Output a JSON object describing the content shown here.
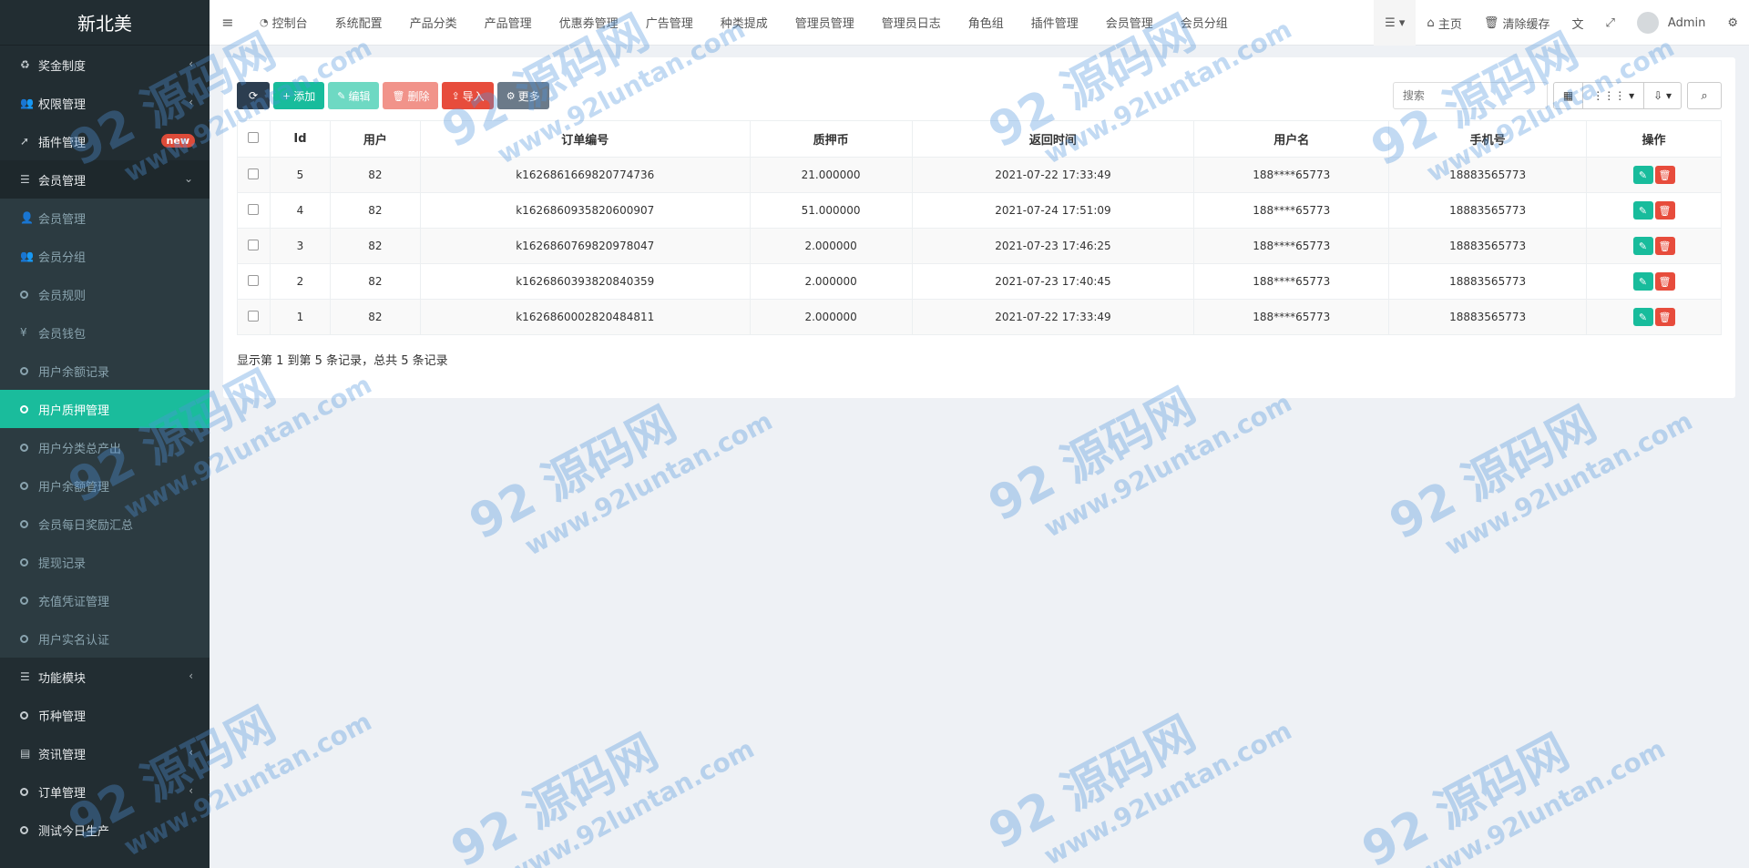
{
  "app": {
    "brand": "新北美"
  },
  "sidebar": {
    "items": [
      {
        "label": "奖金制度",
        "icon": "recycle-icon",
        "chevron": "‹"
      },
      {
        "label": "权限管理",
        "icon": "users-icon",
        "chevron": "‹"
      },
      {
        "label": "插件管理",
        "icon": "rocket-icon",
        "badge": "new"
      },
      {
        "label": "会员管理",
        "icon": "list-icon",
        "chevron": "⌄"
      },
      {
        "label": "会员管理",
        "icon": "user-icon"
      },
      {
        "label": "会员分组",
        "icon": "users-icon"
      },
      {
        "label": "会员规则",
        "icon": "circle-icon"
      },
      {
        "label": "会员钱包",
        "icon": "yen-icon"
      },
      {
        "label": "用户余额记录",
        "icon": "circle-icon"
      },
      {
        "label": "用户质押管理",
        "icon": "circle-icon"
      },
      {
        "label": "用户分类总产出",
        "icon": "circle-icon"
      },
      {
        "label": "用户余额管理",
        "icon": "circle-icon"
      },
      {
        "label": "会员每日奖励汇总",
        "icon": "circle-icon"
      },
      {
        "label": "提现记录",
        "icon": "circle-icon"
      },
      {
        "label": "充值凭证管理",
        "icon": "circle-icon"
      },
      {
        "label": "用户实名认证",
        "icon": "circle-icon"
      },
      {
        "label": "功能模块",
        "icon": "list-icon",
        "chevron": "‹"
      },
      {
        "label": "币种管理",
        "icon": "circle-icon"
      },
      {
        "label": "资讯管理",
        "icon": "news-icon",
        "chevron": "‹"
      },
      {
        "label": "订单管理",
        "icon": "circle-icon",
        "chevron": "‹"
      },
      {
        "label": "测试今日生产",
        "icon": "circle-icon"
      }
    ]
  },
  "topnav": {
    "items": [
      "控制台",
      "系统配置",
      "产品分类",
      "产品管理",
      "优惠券管理",
      "广告管理",
      "种类提成",
      "管理员管理",
      "管理员日志",
      "角色组",
      "插件管理",
      "会员管理",
      "会员分组"
    ],
    "home": "主页",
    "clear_cache": "清除缓存",
    "user": "Admin"
  },
  "toolbar": {
    "add": "添加",
    "edit": "编辑",
    "delete": "删除",
    "import": "导入",
    "more": "更多",
    "search_placeholder": "搜索"
  },
  "table": {
    "columns": [
      "Id",
      "用户",
      "订单编号",
      "质押币",
      "返回时间",
      "用户名",
      "手机号",
      "操作"
    ],
    "rows": [
      {
        "id": "5",
        "user": "82",
        "order": "k1626861669820774736",
        "amount": "21.000000",
        "time": "2021-07-22 17:33:49",
        "username": "188****65773",
        "phone": "18883565773"
      },
      {
        "id": "4",
        "user": "82",
        "order": "k1626860935820600907",
        "amount": "51.000000",
        "time": "2021-07-24 17:51:09",
        "username": "188****65773",
        "phone": "18883565773"
      },
      {
        "id": "3",
        "user": "82",
        "order": "k1626860769820978047",
        "amount": "2.000000",
        "time": "2021-07-23 17:46:25",
        "username": "188****65773",
        "phone": "18883565773"
      },
      {
        "id": "2",
        "user": "82",
        "order": "k1626860393820840359",
        "amount": "2.000000",
        "time": "2021-07-23 17:40:45",
        "username": "188****65773",
        "phone": "18883565773"
      },
      {
        "id": "1",
        "user": "82",
        "order": "k1626860002820484811",
        "amount": "2.000000",
        "time": "2021-07-22 17:33:49",
        "username": "188****65773",
        "phone": "18883565773"
      }
    ],
    "footer": "显示第 1 到第 5 条记录，总共 5 条记录"
  },
  "watermark": {
    "main": "92 源码网",
    "sub": "www.92luntan.com"
  },
  "colors": {
    "sidebar_bg": "#222d32",
    "active": "#1abc9c",
    "danger": "#e74c3c",
    "dark": "#2c3e50"
  }
}
